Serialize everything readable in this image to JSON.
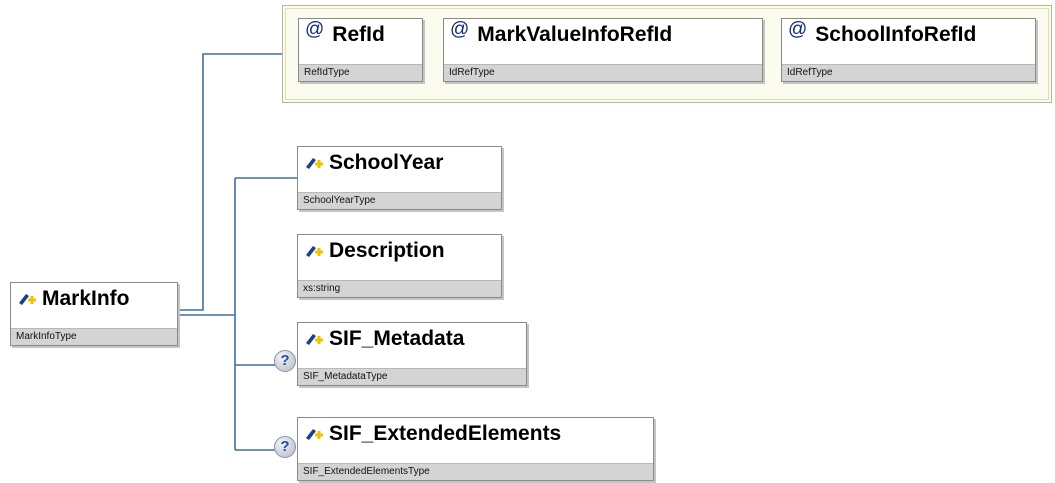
{
  "root": {
    "name": "MarkInfo",
    "type": "MarkInfoType",
    "icon": "element-icon"
  },
  "attributes": [
    {
      "name": "RefId",
      "type": "RefIdType",
      "icon": "at-icon"
    },
    {
      "name": "MarkValueInfoRefId",
      "type": "IdRefType",
      "icon": "at-icon"
    },
    {
      "name": "SchoolInfoRefId",
      "type": "IdRefType",
      "icon": "at-icon"
    }
  ],
  "elements": [
    {
      "name": "SchoolYear",
      "type": "SchoolYearType",
      "icon": "element-icon",
      "optional": false
    },
    {
      "name": "Description",
      "type": "xs:string",
      "icon": "element-icon",
      "optional": false
    },
    {
      "name": "SIF_Metadata",
      "type": "SIF_MetadataType",
      "icon": "element-icon",
      "optional": true,
      "optional_marker": "?"
    },
    {
      "name": "SIF_ExtendedElements",
      "type": "SIF_ExtendedElementsType",
      "icon": "element-icon",
      "optional": true,
      "optional_marker": "?"
    }
  ],
  "at_symbol": "@",
  "colors": {
    "connector": "#3f6fa3",
    "attr_group_bg": "#fcfcee",
    "type_band": "#d4d4d4",
    "icon_blue": "#1a3d8f",
    "icon_yellow": "#f2c200"
  }
}
